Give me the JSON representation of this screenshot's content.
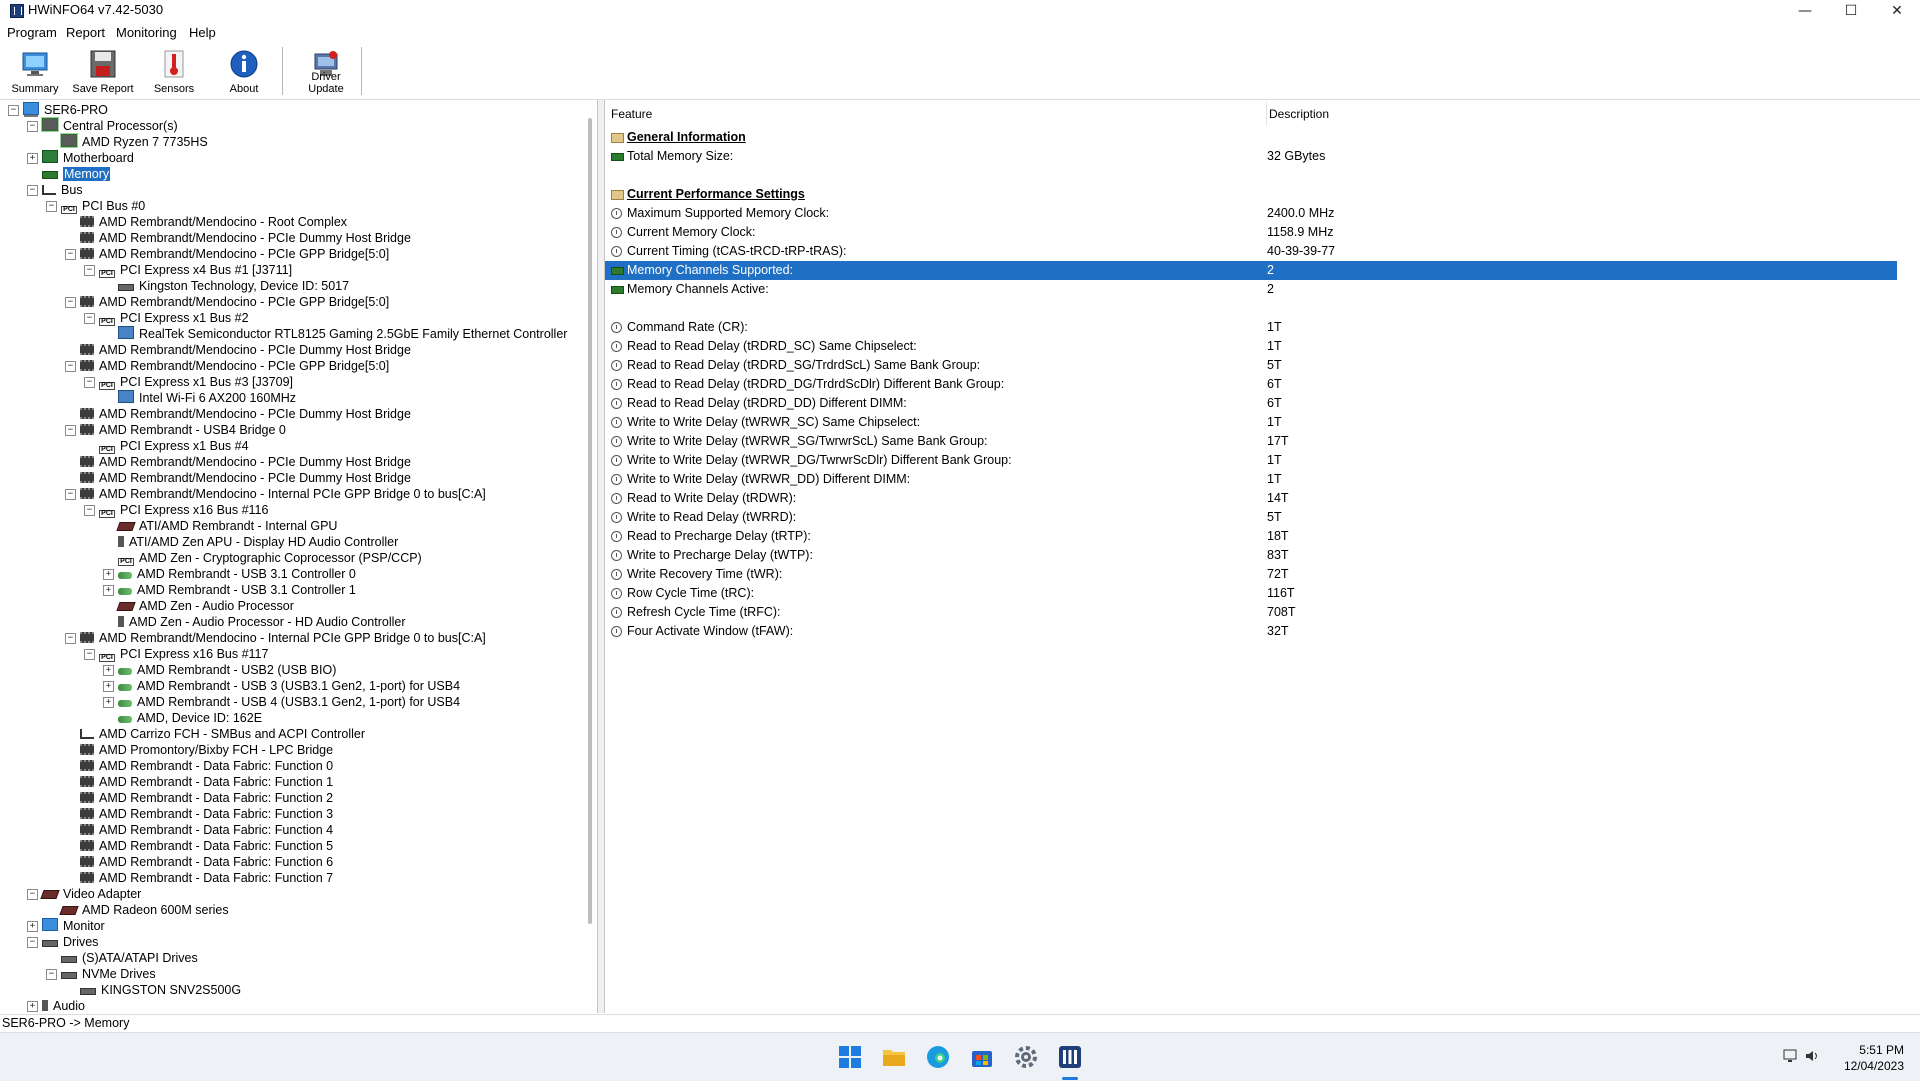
{
  "window": {
    "title": "HWiNFO64 v7.42-5030",
    "minimize_icon": "minimize-icon",
    "maximize_icon": "maximize-icon",
    "close_icon": "close-icon"
  },
  "menu": [
    "Program",
    "Report",
    "Monitoring",
    "Help"
  ],
  "toolbar": [
    {
      "label": "Summary",
      "icon": "summary-monitor-icon"
    },
    {
      "label": "Save Report",
      "icon": "save-floppy-icon"
    },
    {
      "label": "Sensors",
      "icon": "thermometer-icon"
    },
    {
      "label": "About",
      "icon": "info-icon"
    },
    {
      "label": "Driver Update",
      "icon": "driver-update-icon"
    }
  ],
  "tree": [
    {
      "label": "SER6-PRO",
      "depth": 0,
      "exp": "-",
      "icon": "comp"
    },
    {
      "label": "Central Processor(s)",
      "depth": 1,
      "exp": "-",
      "icon": "cpu"
    },
    {
      "label": "AMD Ryzen 7 7735HS",
      "depth": 2,
      "exp": "",
      "icon": "cpu"
    },
    {
      "label": "Motherboard",
      "depth": 1,
      "exp": "+",
      "icon": "board"
    },
    {
      "label": "Memory",
      "depth": 1,
      "exp": "",
      "icon": "mem",
      "selected": true
    },
    {
      "label": "Bus",
      "depth": 1,
      "exp": "-",
      "icon": "bus"
    },
    {
      "label": "PCI Bus #0",
      "depth": 2,
      "exp": "-",
      "icon": "pci"
    },
    {
      "label": "AMD Rembrandt/Mendocino - Root Complex",
      "depth": 3,
      "exp": "",
      "icon": "chip"
    },
    {
      "label": "AMD Rembrandt/Mendocino - PCIe Dummy Host Bridge",
      "depth": 3,
      "exp": "",
      "icon": "chip"
    },
    {
      "label": "AMD Rembrandt/Mendocino - PCIe GPP Bridge[5:0]",
      "depth": 3,
      "exp": "-",
      "icon": "chip"
    },
    {
      "label": "PCI Express x4 Bus #1 [J3711]",
      "depth": 4,
      "exp": "-",
      "icon": "pci"
    },
    {
      "label": "Kingston Technology, Device ID: 5017",
      "depth": 5,
      "exp": "",
      "icon": "drive"
    },
    {
      "label": "AMD Rembrandt/Mendocino - PCIe GPP Bridge[5:0]",
      "depth": 3,
      "exp": "-",
      "icon": "chip"
    },
    {
      "label": "PCI Express x1 Bus #2",
      "depth": 4,
      "exp": "-",
      "icon": "pci"
    },
    {
      "label": "RealTek Semiconductor RTL8125 Gaming 2.5GbE Family Ethernet Controller",
      "depth": 5,
      "exp": "",
      "icon": "net"
    },
    {
      "label": "AMD Rembrandt/Mendocino - PCIe Dummy Host Bridge",
      "depth": 3,
      "exp": "",
      "icon": "chip"
    },
    {
      "label": "AMD Rembrandt/Mendocino - PCIe GPP Bridge[5:0]",
      "depth": 3,
      "exp": "-",
      "icon": "chip"
    },
    {
      "label": "PCI Express x1 Bus #3 [J3709]",
      "depth": 4,
      "exp": "-",
      "icon": "pci"
    },
    {
      "label": "Intel Wi-Fi 6 AX200 160MHz",
      "depth": 5,
      "exp": "",
      "icon": "net"
    },
    {
      "label": "AMD Rembrandt/Mendocino - PCIe Dummy Host Bridge",
      "depth": 3,
      "exp": "",
      "icon": "chip"
    },
    {
      "label": "AMD Rembrandt - USB4 Bridge 0",
      "depth": 3,
      "exp": "-",
      "icon": "chip"
    },
    {
      "label": "PCI Express x1 Bus #4",
      "depth": 4,
      "exp": "",
      "icon": "pci"
    },
    {
      "label": "AMD Rembrandt/Mendocino - PCIe Dummy Host Bridge",
      "depth": 3,
      "exp": "",
      "icon": "chip"
    },
    {
      "label": "AMD Rembrandt/Mendocino - PCIe Dummy Host Bridge",
      "depth": 3,
      "exp": "",
      "icon": "chip"
    },
    {
      "label": "AMD Rembrandt/Mendocino - Internal PCIe GPP Bridge 0 to bus[C:A]",
      "depth": 3,
      "exp": "-",
      "icon": "chip"
    },
    {
      "label": "PCI Express x16 Bus #116",
      "depth": 4,
      "exp": "-",
      "icon": "pci"
    },
    {
      "label": "ATI/AMD Rembrandt - Internal GPU",
      "depth": 5,
      "exp": "",
      "icon": "gpu"
    },
    {
      "label": "ATI/AMD Zen APU - Display HD Audio Controller",
      "depth": 5,
      "exp": "",
      "icon": "audio"
    },
    {
      "label": "AMD Zen - Cryptographic Coprocessor (PSP/CCP)",
      "depth": 5,
      "exp": "",
      "icon": "pci"
    },
    {
      "label": "AMD Rembrandt - USB 3.1 Controller 0",
      "depth": 5,
      "exp": "+",
      "icon": "usb"
    },
    {
      "label": "AMD Rembrandt - USB 3.1 Controller 1",
      "depth": 5,
      "exp": "+",
      "icon": "usb"
    },
    {
      "label": "AMD Zen - Audio Processor",
      "depth": 5,
      "exp": "",
      "icon": "gpu"
    },
    {
      "label": "AMD Zen - Audio Processor - HD Audio Controller",
      "depth": 5,
      "exp": "",
      "icon": "audio"
    },
    {
      "label": "AMD Rembrandt/Mendocino - Internal PCIe GPP Bridge 0 to bus[C:A]",
      "depth": 3,
      "exp": "-",
      "icon": "chip"
    },
    {
      "label": "PCI Express x16 Bus #117",
      "depth": 4,
      "exp": "-",
      "icon": "pci"
    },
    {
      "label": "AMD Rembrandt - USB2 (USB BIO)",
      "depth": 5,
      "exp": "+",
      "icon": "usb"
    },
    {
      "label": "AMD Rembrandt - USB 3 (USB3.1 Gen2, 1-port) for USB4",
      "depth": 5,
      "exp": "+",
      "icon": "usb"
    },
    {
      "label": "AMD Rembrandt - USB 4 (USB3.1 Gen2, 1-port) for USB4",
      "depth": 5,
      "exp": "+",
      "icon": "usb"
    },
    {
      "label": "AMD, Device ID: 162E",
      "depth": 5,
      "exp": "",
      "icon": "usb"
    },
    {
      "label": "AMD Carrizo FCH - SMBus and ACPI Controller",
      "depth": 3,
      "exp": "",
      "icon": "bus"
    },
    {
      "label": "AMD Promontory/Bixby FCH - LPC Bridge",
      "depth": 3,
      "exp": "",
      "icon": "chip"
    },
    {
      "label": "AMD Rembrandt - Data Fabric: Function 0",
      "depth": 3,
      "exp": "",
      "icon": "chip"
    },
    {
      "label": "AMD Rembrandt - Data Fabric: Function 1",
      "depth": 3,
      "exp": "",
      "icon": "chip"
    },
    {
      "label": "AMD Rembrandt - Data Fabric: Function 2",
      "depth": 3,
      "exp": "",
      "icon": "chip"
    },
    {
      "label": "AMD Rembrandt - Data Fabric: Function 3",
      "depth": 3,
      "exp": "",
      "icon": "chip"
    },
    {
      "label": "AMD Rembrandt - Data Fabric: Function 4",
      "depth": 3,
      "exp": "",
      "icon": "chip"
    },
    {
      "label": "AMD Rembrandt - Data Fabric: Function 5",
      "depth": 3,
      "exp": "",
      "icon": "chip"
    },
    {
      "label": "AMD Rembrandt - Data Fabric: Function 6",
      "depth": 3,
      "exp": "",
      "icon": "chip"
    },
    {
      "label": "AMD Rembrandt - Data Fabric: Function 7",
      "depth": 3,
      "exp": "",
      "icon": "chip"
    },
    {
      "label": "Video Adapter",
      "depth": 1,
      "exp": "-",
      "icon": "gpu"
    },
    {
      "label": "AMD Radeon 600M series",
      "depth": 2,
      "exp": "",
      "icon": "gpu"
    },
    {
      "label": "Monitor",
      "depth": 1,
      "exp": "+",
      "icon": "monitor"
    },
    {
      "label": "Drives",
      "depth": 1,
      "exp": "-",
      "icon": "drive"
    },
    {
      "label": "(S)ATA/ATAPI Drives",
      "depth": 2,
      "exp": "",
      "icon": "drive"
    },
    {
      "label": "NVMe Drives",
      "depth": 2,
      "exp": "-",
      "icon": "drive"
    },
    {
      "label": "KINGSTON SNV2S500G",
      "depth": 3,
      "exp": "",
      "icon": "drive"
    },
    {
      "label": "Audio",
      "depth": 1,
      "exp": "+",
      "icon": "audio"
    }
  ],
  "list_columns": {
    "feature": "Feature",
    "description": "Description"
  },
  "list_rows": [
    {
      "feature": "General Information",
      "desc": "",
      "type": "group",
      "icon": "group"
    },
    {
      "feature": "Total Memory Size:",
      "desc": "32 GBytes",
      "icon": "memrow"
    },
    {
      "feature": "",
      "desc": "",
      "type": "blank"
    },
    {
      "feature": "Current Performance Settings",
      "desc": "",
      "type": "group",
      "icon": "group"
    },
    {
      "feature": "Maximum Supported Memory Clock:",
      "desc": "2400.0 MHz",
      "icon": "clock"
    },
    {
      "feature": "Current Memory Clock:",
      "desc": "1158.9 MHz",
      "icon": "clock"
    },
    {
      "feature": "Current Timing (tCAS-tRCD-tRP-tRAS):",
      "desc": "40-39-39-77",
      "icon": "clock"
    },
    {
      "feature": "Memory Channels Supported:",
      "desc": "2",
      "icon": "memrow",
      "selected": true
    },
    {
      "feature": "Memory Channels Active:",
      "desc": "2",
      "icon": "memrow"
    },
    {
      "feature": "",
      "desc": "",
      "type": "blank"
    },
    {
      "feature": "Command Rate (CR):",
      "desc": "1T",
      "icon": "clock"
    },
    {
      "feature": "Read to Read Delay (tRDRD_SC) Same Chipselect:",
      "desc": "1T",
      "icon": "clock"
    },
    {
      "feature": "Read to Read Delay (tRDRD_SG/TrdrdScL) Same Bank Group:",
      "desc": "5T",
      "icon": "clock"
    },
    {
      "feature": "Read to Read Delay (tRDRD_DG/TrdrdScDlr) Different Bank Group:",
      "desc": "6T",
      "icon": "clock"
    },
    {
      "feature": "Read to Read Delay (tRDRD_DD) Different DIMM:",
      "desc": "6T",
      "icon": "clock"
    },
    {
      "feature": "Write to Write Delay (tWRWR_SC) Same Chipselect:",
      "desc": "1T",
      "icon": "clock"
    },
    {
      "feature": "Write to Write Delay (tWRWR_SG/TwrwrScL) Same Bank Group:",
      "desc": "17T",
      "icon": "clock"
    },
    {
      "feature": "Write to Write Delay (tWRWR_DG/TwrwrScDlr) Different Bank Group:",
      "desc": "1T",
      "icon": "clock"
    },
    {
      "feature": "Write to Write Delay (tWRWR_DD) Different DIMM:",
      "desc": "1T",
      "icon": "clock"
    },
    {
      "feature": "Read to Write Delay (tRDWR):",
      "desc": "14T",
      "icon": "clock"
    },
    {
      "feature": "Write to Read Delay (tWRRD):",
      "desc": "5T",
      "icon": "clock"
    },
    {
      "feature": "Read to Precharge Delay (tRTP):",
      "desc": "18T",
      "icon": "clock"
    },
    {
      "feature": "Write to Precharge Delay (tWTP):",
      "desc": "83T",
      "icon": "clock"
    },
    {
      "feature": "Write Recovery Time (tWR):",
      "desc": "72T",
      "icon": "clock"
    },
    {
      "feature": "Row Cycle Time (tRC):",
      "desc": "116T",
      "icon": "clock"
    },
    {
      "feature": "Refresh Cycle Time (tRFC):",
      "desc": "708T",
      "icon": "clock"
    },
    {
      "feature": "Four Activate Window (tFAW):",
      "desc": "32T",
      "icon": "clock"
    }
  ],
  "status": "SER6-PRO -> Memory",
  "taskbar": {
    "icons": [
      "start-windows-icon",
      "file-explorer-icon",
      "edge-browser-icon",
      "store-icon",
      "settings-gear-icon",
      "hwinfo-icon"
    ],
    "time": "5:51 PM",
    "date": "12/04/2023"
  }
}
